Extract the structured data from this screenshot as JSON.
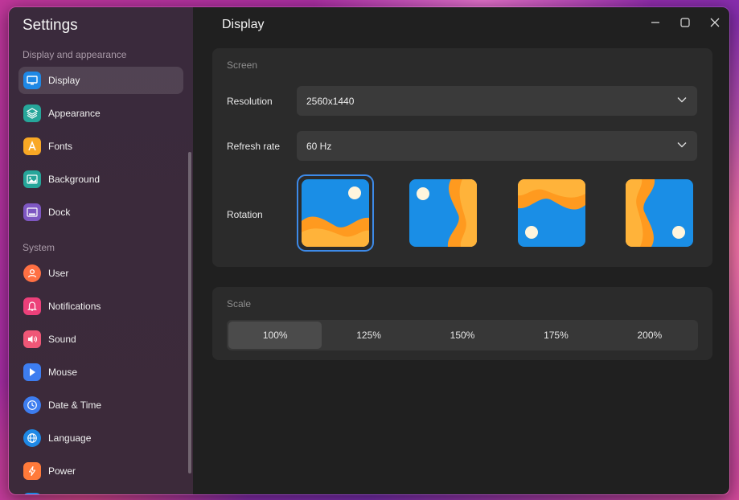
{
  "sidebar": {
    "title": "Settings",
    "section1": "Display and appearance",
    "section2": "System",
    "items": [
      {
        "label": "Display",
        "icon": "monitor-icon",
        "color": "#1e88e5"
      },
      {
        "label": "Appearance",
        "icon": "layers-icon",
        "color": "#26a69a"
      },
      {
        "label": "Fonts",
        "icon": "font-icon",
        "color": "#f9a825"
      },
      {
        "label": "Background",
        "icon": "image-icon",
        "color": "#26a69a"
      },
      {
        "label": "Dock",
        "icon": "dock-icon",
        "color": "#7e57c2"
      },
      {
        "label": "User",
        "icon": "user-icon",
        "color": "#ff7043"
      },
      {
        "label": "Notifications",
        "icon": "bell-icon",
        "color": "#ec407a"
      },
      {
        "label": "Sound",
        "icon": "speaker-icon",
        "color": "#ef5777"
      },
      {
        "label": "Mouse",
        "icon": "cursor-icon",
        "color": "#3d7df0"
      },
      {
        "label": "Date & Time",
        "icon": "clock-icon",
        "color": "#3d7df0"
      },
      {
        "label": "Language",
        "icon": "globe-icon",
        "color": "#1e88e5"
      },
      {
        "label": "Power",
        "icon": "bolt-icon",
        "color": "#ff7a3a"
      }
    ]
  },
  "main": {
    "title": "Display",
    "screen": {
      "label": "Screen",
      "resolution_label": "Resolution",
      "resolution_value": "2560x1440",
      "refresh_label": "Refresh rate",
      "refresh_value": "60 Hz",
      "rotation_label": "Rotation",
      "rotation_selected": 0
    },
    "scale": {
      "label": "Scale",
      "options": [
        "100%",
        "125%",
        "150%",
        "175%",
        "200%"
      ],
      "selected": "100%"
    }
  },
  "colors": {
    "accent": "#3d8ae8",
    "wallpaper_blue": "#1a8ee6",
    "wallpaper_orange": "#ff9a1f"
  }
}
